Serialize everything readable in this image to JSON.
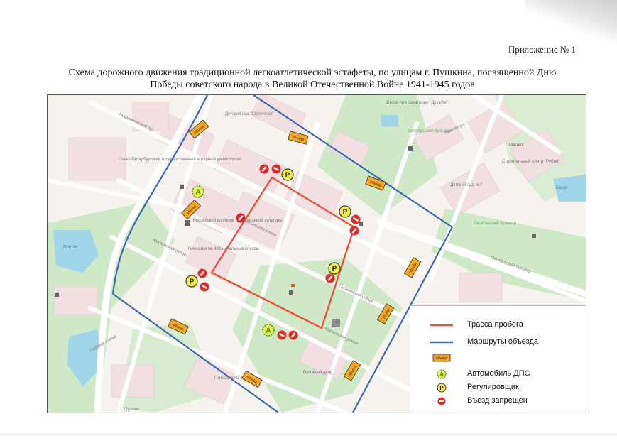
{
  "header": {
    "appendix": "Приложение № 1",
    "title_line1": "Схема дорожного движения традиционной легкоатлетической эстафеты, по улицам г. Пушкина, посвященной Дню",
    "title_line2": "Победы советского народа в Великой Отечественной Войне 1941-1945 годов"
  },
  "legend": {
    "items": [
      {
        "label": "Трасса пробега",
        "symbol": "red-line"
      },
      {
        "label": "Маршруты объезда",
        "symbol": "blue-line"
      },
      {
        "label": "",
        "symbol": "detour-sign"
      },
      {
        "label": "Автомобиль ДПС",
        "symbol": "police-car-marker"
      },
      {
        "label": "Регулировщик",
        "symbol": "traffic-controller-marker"
      },
      {
        "label": "Въезд запрещен",
        "symbol": "no-entry-sign"
      }
    ]
  },
  "map": {
    "colors": {
      "race_route": "#e8503a",
      "detour_route": "#3d6aa8",
      "park": "#cfe9c8",
      "water": "#9fd6e8",
      "building": "#f1dfe1",
      "road": "#ffffff",
      "sign_fill": "#f2a623",
      "marker_fill": "#f4ec40"
    },
    "labels": {
      "school": "Школа при санатории \"Дружба\"",
      "kindergarten_top": "Детский сад \"Светлячок\"",
      "kindergarten_7": "Детский сад №7",
      "oktyabrsky_boulevard": "Октябрьский бульвар",
      "oktyabrsky_boulevard_2": "Октябрьский бульвар",
      "oktyabrsky_boulevard_road": "Октябрьский бульвар",
      "agrarian_university": "Санкт-Петербургский государственный аграрный университет",
      "college": "Российский колледж традиционной культуры",
      "gymnasium": "Гимназия № 406 начальные классы",
      "gymnasium_2": "Гимназия № 406",
      "guest_house": "Гостиный двор",
      "moskovskaya_1": "Московская улица",
      "moskovskaya_2": "Московская улица",
      "pushkinskaya": "Пушкинская улица",
      "sadovaya": "Садовая улица",
      "leontievskaya": "Леонтьевская улица",
      "akademichesky": "Академический пр.",
      "pushkin": "Пушкин",
      "magnit": "Магнит",
      "fontan": "Фонтан",
      "nizhnyaya": "Нижняя ул.",
      "store": "Строительный центр \"Рубин\"",
      "ovrag": "Овраг",
      "sign_text": "объезд"
    },
    "marker_letters": {
      "police": "A",
      "controller": "P"
    }
  }
}
